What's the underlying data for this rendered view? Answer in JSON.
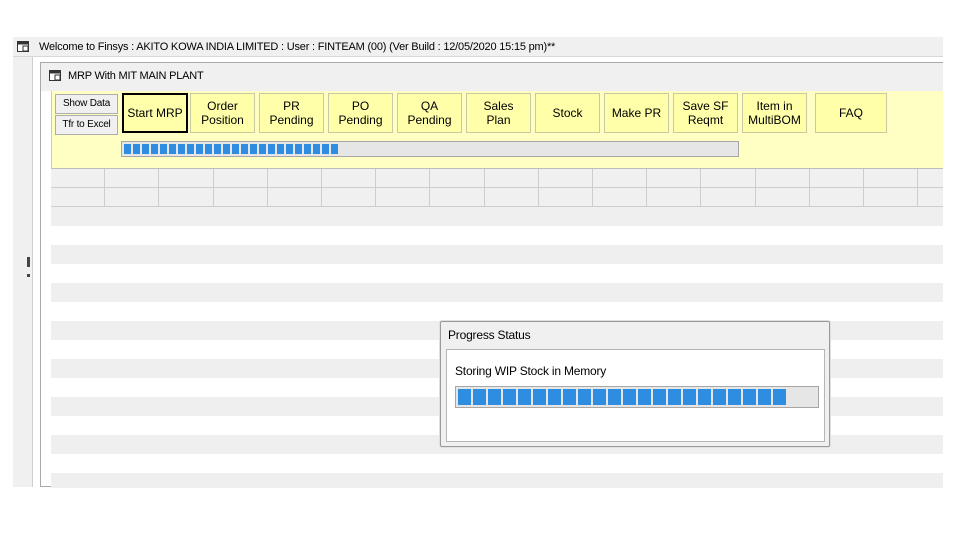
{
  "window": {
    "title": "Welcome to Finsys : AKITO KOWA INDIA LIMITED : User : FINTEAM (00) (Ver Build : 12/05/2020  15:15 pm)**"
  },
  "child_window": {
    "title": "MRP With MIT MAIN PLANT"
  },
  "toolbar": {
    "show_data_label": "Show Data",
    "to_excel_label": "Tfr to Excel",
    "buttons": [
      {
        "label": "Start MRP"
      },
      {
        "label": "Order\nPosition"
      },
      {
        "label": "PR\nPending"
      },
      {
        "label": "PO\nPending"
      },
      {
        "label": "QA\nPending"
      },
      {
        "label": "Sales\nPlan"
      },
      {
        "label": "Stock"
      },
      {
        "label": "Make PR"
      },
      {
        "label": "Save SF\nReqmt"
      },
      {
        "label": "Item in\nMultiBOM"
      },
      {
        "label": "FAQ"
      }
    ],
    "progress_percent": 35
  },
  "progress_dialog": {
    "title": "Progress Status",
    "message": "Storing WIP Stock in Memory",
    "progress_percent": 92
  },
  "colors": {
    "toolbar_bg": "#ffffc4",
    "button_bg": "#ffffaa",
    "progress_fill": "#2e8de0",
    "grid_alt_row": "#efefef"
  },
  "icons": {
    "window_icon": "window-icon"
  }
}
